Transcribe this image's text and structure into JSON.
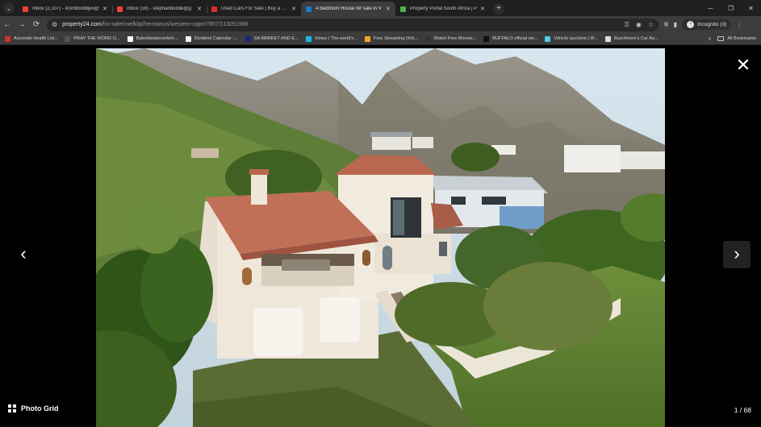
{
  "browser": {
    "tabs": [
      {
        "title": "Inbox (2,107) - krombootbjes@",
        "icon": "gmail-icon",
        "color": "#ea4335"
      },
      {
        "title": "Inbox (18) - stephanbodde@g",
        "icon": "gmail-icon",
        "color": "#ea4335"
      },
      {
        "title": "Used Cars For Sale | Buy a Seco",
        "icon": "cars-icon",
        "color": "#d32f2f"
      },
      {
        "title": "4 Bedroom House for sale in V",
        "icon": "property24-icon",
        "color": "#1976d2",
        "active": true
      },
      {
        "title": "Property Portal South Africa | P",
        "icon": "private-property-icon",
        "color": "#4caf50"
      }
    ],
    "url_host": "property24.com",
    "url_path": "/for-sale/voelklip/hermanus/western-cape/7857/113051988",
    "incognito_label": "Incognito (3)",
    "bookmarks": [
      {
        "label": "Ascendis Health Ltd...",
        "color": "#d32f2f"
      },
      {
        "label": "PRAY THE WORD O...",
        "color": "#555555"
      },
      {
        "label": "Bybeldeskteverteln...",
        "color": "#ffffff"
      },
      {
        "label": "Dividend Calendar -...",
        "color": "#f5f5f5"
      },
      {
        "label": "SA MARKET AND E...",
        "color": "#1a237e"
      },
      {
        "label": "Vimeo | The world's...",
        "color": "#1ab7ea"
      },
      {
        "label": "Free Streaming Onli...",
        "color": "#f5a623"
      },
      {
        "label": "Watch Free Movies...",
        "color": "#333333"
      },
      {
        "label": "BUFFALO official we...",
        "color": "#111111"
      },
      {
        "label": "Vehicle auctions | W...",
        "color": "#4dd0e1"
      },
      {
        "label": "Burchmore's Car Au...",
        "color": "#e0e0e0"
      }
    ],
    "all_bookmarks_label": "All Bookmarks"
  },
  "viewer": {
    "photo_grid_label": "Photo Grid",
    "counter": "1 / 68",
    "photo_alt": "Aerial view of white two-storey house with terracotta roof below mountains",
    "colors": {
      "background": "#000000",
      "roof": "#b9684f",
      "walls": "#efe7da",
      "mountain": "#8f8b82",
      "grass": "#4c7a2c"
    }
  }
}
